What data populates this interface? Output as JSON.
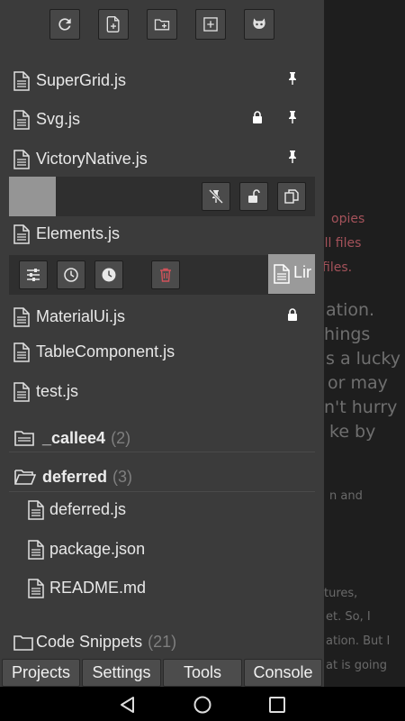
{
  "toolbar": {
    "buttons": [
      {
        "name": "refresh-icon"
      },
      {
        "name": "new-file-icon"
      },
      {
        "name": "new-folder-icon"
      },
      {
        "name": "add-box-icon"
      },
      {
        "name": "github-icon"
      }
    ]
  },
  "files_top": [
    {
      "label": "SuperGrid.js",
      "pinned": true,
      "locked": false
    },
    {
      "label": "Svg.js",
      "pinned": true,
      "locked": true
    },
    {
      "label": "VictoryNative.js",
      "pinned": true,
      "locked": false
    }
  ],
  "strip1": {
    "buttons": [
      "unpin-icon",
      "unlock-icon",
      "copy-icon"
    ]
  },
  "file_elements": {
    "label": "Elements.js"
  },
  "strip2": {
    "buttons": [
      "settings-sliders-icon",
      "history-icon",
      "clock-icon",
      "delete-icon"
    ]
  },
  "drag_ghost": {
    "label": "Lir"
  },
  "files_mid": [
    {
      "label": "MaterialUi.js",
      "locked": true
    },
    {
      "label": "TableComponent.js"
    },
    {
      "label": "test.js"
    }
  ],
  "folders": {
    "callee": {
      "label": "_callee4",
      "count": "(2)"
    },
    "deferred": {
      "label": "deferred",
      "count": "(3)"
    },
    "snippets": {
      "label": "Code Snippets",
      "count": "(21)"
    }
  },
  "deferred_files": [
    {
      "label": "deferred.js"
    },
    {
      "label": "package.json"
    },
    {
      "label": "README.md"
    }
  ],
  "tabs": {
    "projects": "Projects",
    "settings": "Settings",
    "tools": "Tools",
    "console": "Console"
  },
  "background_text": {
    "l1": "opies",
    "l2": "all files",
    "l3": "files.",
    "l4": "ation.",
    "l5": "hings",
    "l6": "s a lucky",
    "l7": "or may",
    "l8": "n't hurry",
    "l9": "ke by",
    "l10": "n and",
    "l11": "tures,",
    "l12": "et. So, I",
    "l13": "ation. But I",
    "l14": "at is going"
  },
  "colors": {
    "drawer_bg": "#3b3b3b",
    "accent_red": "#d0525a",
    "background_red_text": "#a4525a"
  }
}
